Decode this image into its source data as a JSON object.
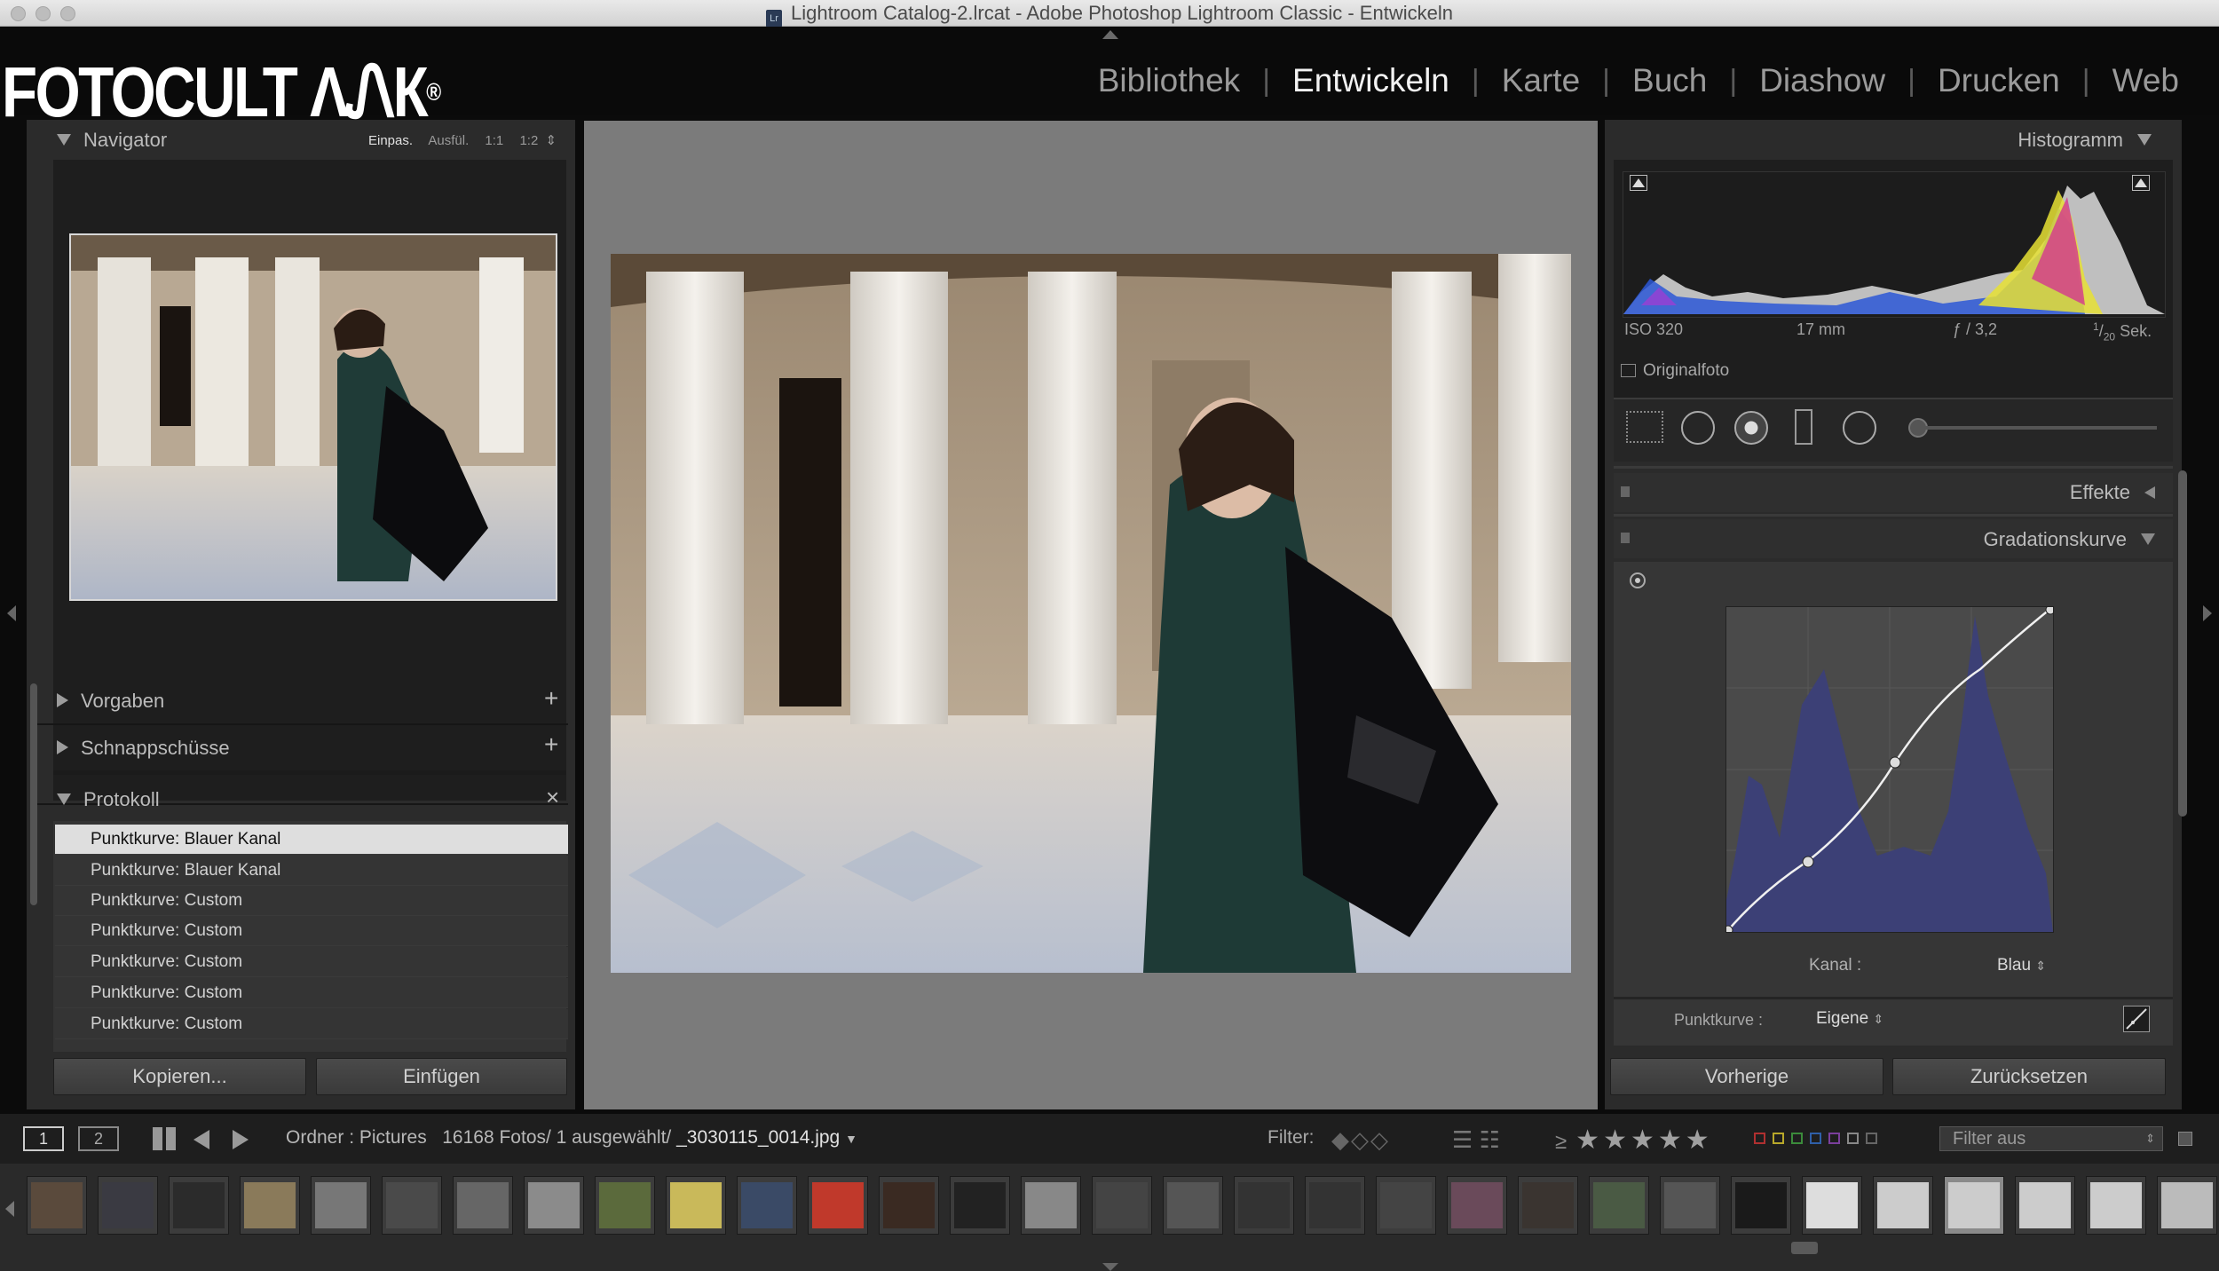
{
  "window": {
    "title": "Lightroom Catalog-2.lrcat - Adobe Photoshop Lightroom Classic - Entwickeln",
    "badge": "Lr"
  },
  "logo": {
    "text": "FOTOCULT ΛᏁК",
    "mark": "®"
  },
  "modules": [
    "Bibliothek",
    "Entwickeln",
    "Karte",
    "Buch",
    "Diashow",
    "Drucken",
    "Web"
  ],
  "active_module": "Entwickeln",
  "navigator": {
    "title": "Navigator",
    "zoom_options": [
      "Einpas.",
      "Ausfül.",
      "1:1",
      "1:2"
    ],
    "zoom_arrow": "⇕"
  },
  "left_panels": {
    "presets": "Vorgaben",
    "snapshots": "Schnappschüsse",
    "history": "Protokoll",
    "plus": "+",
    "close": "×"
  },
  "history_items": [
    "Punktkurve: Blauer Kanal",
    "Punktkurve: Blauer Kanal",
    "Punktkurve: Custom",
    "Punktkurve: Custom",
    "Punktkurve: Custom",
    "Punktkurve: Custom",
    "Punktkurve: Custom"
  ],
  "left_buttons": {
    "copy": "Kopieren...",
    "paste": "Einfügen"
  },
  "histogram": {
    "title": "Histogramm",
    "iso": "ISO 320",
    "focal": "17 mm",
    "aperture": "ƒ / 3,2",
    "shutter_num": "1",
    "shutter_den": "20",
    "shutter_unit": "Sek.",
    "original": "Originalfoto"
  },
  "right_panels": {
    "effects": "Effekte",
    "tone_curve": "Gradationskurve"
  },
  "tone_curve": {
    "channel_label": "Kanal :",
    "channel_value": "Blau",
    "point_curve_label": "Punktkurve :",
    "point_curve_value": "Eigene",
    "updown": "⇕"
  },
  "right_buttons": {
    "previous": "Vorherige",
    "reset": "Zurücksetzen"
  },
  "toolbar": {
    "view1": "1",
    "view2": "2",
    "source_label": "Ordner : Pictures",
    "count": "16168 Fotos/ 1 ausgewählt/",
    "filename": "_3030115_0014.jpg",
    "filter_label": "Filter:",
    "gte": "≥",
    "filter_value": "Filter aus"
  },
  "colors": {
    "bg": "#0b0b0b",
    "panel": "#2b2b2b",
    "label_red": "#c0392b",
    "label_yellow": "#c9b52c",
    "label_green": "#3b8b3b",
    "label_blue": "#2f5fa8",
    "label_purple": "#7b3f9c"
  }
}
